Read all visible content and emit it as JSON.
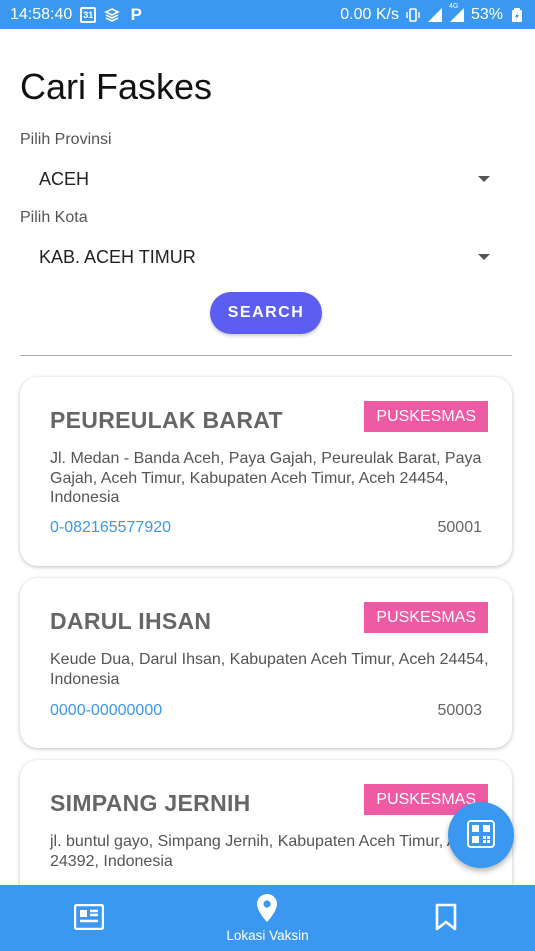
{
  "status_bar": {
    "time": "14:58:40",
    "calendar_day": "31",
    "network_speed": "0.00 K/s",
    "network_type": "4G",
    "battery": "53%"
  },
  "page": {
    "title": "Cari Faskes"
  },
  "form": {
    "province_label": "Pilih Provinsi",
    "province_value": "ACEH",
    "city_label": "Pilih Kota",
    "city_value": "KAB. ACEH TIMUR",
    "search_label": "SEARCH"
  },
  "facilities": [
    {
      "name": "PEUREULAK BARAT",
      "type": "PUSKESMAS",
      "address": "Jl. Medan - Banda Aceh, Paya Gajah, Peureulak Barat, Paya Gajah, Aceh Timur, Kabupaten Aceh Timur, Aceh 24454, Indonesia",
      "phone": "0-082165577920",
      "code": "50001"
    },
    {
      "name": "DARUL IHSAN",
      "type": "PUSKESMAS",
      "address": "Keude Dua, Darul Ihsan, Kabupaten Aceh Timur, Aceh 24454, Indonesia",
      "phone": "0000-00000000",
      "code": "50003"
    },
    {
      "name": "SIMPANG JERNIH",
      "type": "PUSKESMAS",
      "address": "jl. buntul gayo, Simpang Jernih, Kabupaten Aceh Timur, Aceh 24392, Indonesia",
      "phone": "",
      "code": ""
    }
  ],
  "fab": {
    "icon": "qr-code-icon"
  },
  "bottom_nav": {
    "items": [
      {
        "icon": "news-icon",
        "label": ""
      },
      {
        "icon": "location-pin-icon",
        "label": "Lokasi Vaksin"
      },
      {
        "icon": "bookmark-icon",
        "label": ""
      }
    ]
  },
  "colors": {
    "primary": "#3a98f0",
    "search_button": "#5b5ef0",
    "badge": "#ef5aa4",
    "link": "#3a98f0"
  }
}
